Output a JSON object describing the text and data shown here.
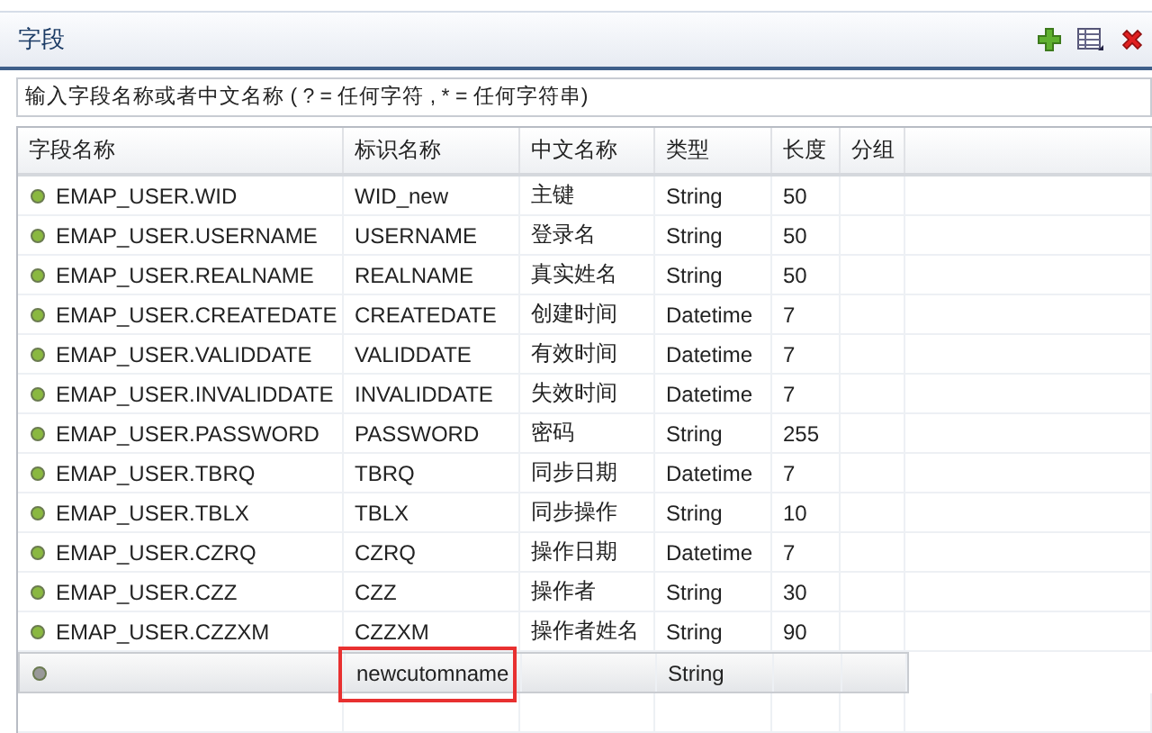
{
  "panel": {
    "title": "字段"
  },
  "toolbar": [
    {
      "kind": "add"
    },
    {
      "kind": "columns"
    },
    {
      "kind": "delete"
    }
  ],
  "filter": {
    "placeholder": "输入字段名称或者中文名称 ( ? = 任何字符 , * = 任何字符串)"
  },
  "table": {
    "columns": [
      "字段名称",
      "标识名称",
      "中文名称",
      "类型",
      "长度",
      "分组"
    ],
    "rows": [
      {
        "color": "#8ab840",
        "selected": false,
        "outlined": false,
        "cells": [
          "EMAP_USER.WID",
          "WID_new",
          "主键",
          "String",
          "50",
          ""
        ]
      },
      {
        "color": "#8ab840",
        "selected": false,
        "outlined": false,
        "cells": [
          "EMAP_USER.USERNAME",
          "USERNAME",
          "登录名",
          "String",
          "50",
          ""
        ]
      },
      {
        "color": "#8ab840",
        "selected": false,
        "outlined": false,
        "cells": [
          "EMAP_USER.REALNAME",
          "REALNAME",
          "真实姓名",
          "String",
          "50",
          ""
        ]
      },
      {
        "color": "#8ab840",
        "selected": false,
        "outlined": false,
        "cells": [
          "EMAP_USER.CREATEDATE",
          "CREATEDATE",
          "创建时间",
          "Datetime",
          "7",
          ""
        ]
      },
      {
        "color": "#8ab840",
        "selected": false,
        "outlined": false,
        "cells": [
          "EMAP_USER.VALIDDATE",
          "VALIDDATE",
          "有效时间",
          "Datetime",
          "7",
          ""
        ]
      },
      {
        "color": "#8ab840",
        "selected": false,
        "outlined": false,
        "cells": [
          "EMAP_USER.INVALIDDATE",
          "INVALIDDATE",
          "失效时间",
          "Datetime",
          "7",
          ""
        ]
      },
      {
        "color": "#8ab840",
        "selected": false,
        "outlined": false,
        "cells": [
          "EMAP_USER.PASSWORD",
          "PASSWORD",
          "密码",
          "String",
          "255",
          ""
        ]
      },
      {
        "color": "#8ab840",
        "selected": false,
        "outlined": false,
        "cells": [
          "EMAP_USER.TBRQ",
          "TBRQ",
          "同步日期",
          "Datetime",
          "7",
          ""
        ]
      },
      {
        "color": "#8ab840",
        "selected": false,
        "outlined": false,
        "cells": [
          "EMAP_USER.TBLX",
          "TBLX",
          "同步操作",
          "String",
          "10",
          ""
        ]
      },
      {
        "color": "#8ab840",
        "selected": false,
        "outlined": false,
        "cells": [
          "EMAP_USER.CZRQ",
          "CZRQ",
          "操作日期",
          "Datetime",
          "7",
          ""
        ]
      },
      {
        "color": "#8ab840",
        "selected": false,
        "outlined": false,
        "cells": [
          "EMAP_USER.CZZ",
          "CZZ",
          "操作者",
          "String",
          "30",
          ""
        ]
      },
      {
        "color": "#8ab840",
        "selected": false,
        "outlined": false,
        "cells": [
          "EMAP_USER.CZZXM",
          "CZZXM",
          "操作者姓名",
          "String",
          "90",
          ""
        ]
      },
      {
        "color": "#999999",
        "selected": true,
        "outlined": true,
        "cells": [
          "",
          "newcutomname",
          "",
          "String",
          "",
          ""
        ]
      }
    ]
  }
}
